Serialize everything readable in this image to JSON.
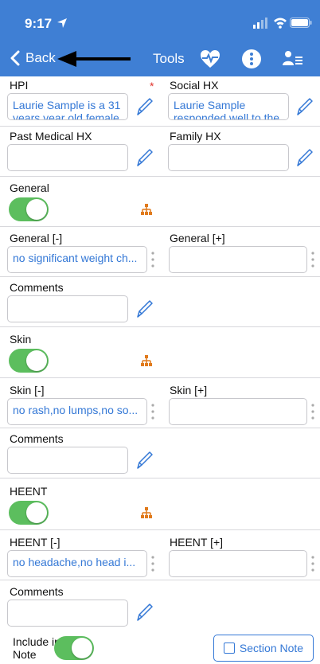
{
  "status": {
    "time": "9:17"
  },
  "nav": {
    "back_label": "Back",
    "tools_label": "Tools"
  },
  "hx": {
    "hpi_label": "HPI",
    "hpi_required": "*",
    "hpi_value": "Laurie Sample is a 31 years year old female",
    "social_label": "Social HX",
    "social_value": "Laurie Sample responded well to the",
    "pmh_label": "Past Medical HX",
    "pmh_value": "",
    "family_label": "Family HX",
    "family_value": ""
  },
  "sections": [
    {
      "title": "General",
      "neg_label": "General [-]",
      "neg_value": "no significant weight ch...",
      "pos_label": "General [+]",
      "pos_value": "",
      "comments_label": "Comments",
      "comments_value": ""
    },
    {
      "title": "Skin",
      "neg_label": "Skin [-]",
      "neg_value": "no rash,no lumps,no so...",
      "pos_label": "Skin [+]",
      "pos_value": "",
      "comments_label": "Comments",
      "comments_value": ""
    },
    {
      "title": "HEENT",
      "neg_label": "HEENT [-]",
      "neg_value": "no headache,no head i...",
      "pos_label": "HEENT [+]",
      "pos_value": "",
      "comments_label": "Comments",
      "comments_value": ""
    }
  ],
  "footer": {
    "include_label": "Include in Note",
    "section_note_label": "Section Note"
  },
  "colors": {
    "nav_blue": "#3f7fd4",
    "value_blue": "#3478d6",
    "toggle_green": "#5cbe5e",
    "tree_orange": "#e07a1c",
    "required_red": "#e0322a"
  },
  "icons": [
    "location-arrow-icon",
    "signal-icon",
    "wifi-icon",
    "battery-icon",
    "chevron-left-icon",
    "heart-pulse-icon",
    "more-vertical-icon",
    "user-list-icon",
    "pencil-icon",
    "hierarchy-icon",
    "drag-dots-icon",
    "checkbox-icon"
  ]
}
